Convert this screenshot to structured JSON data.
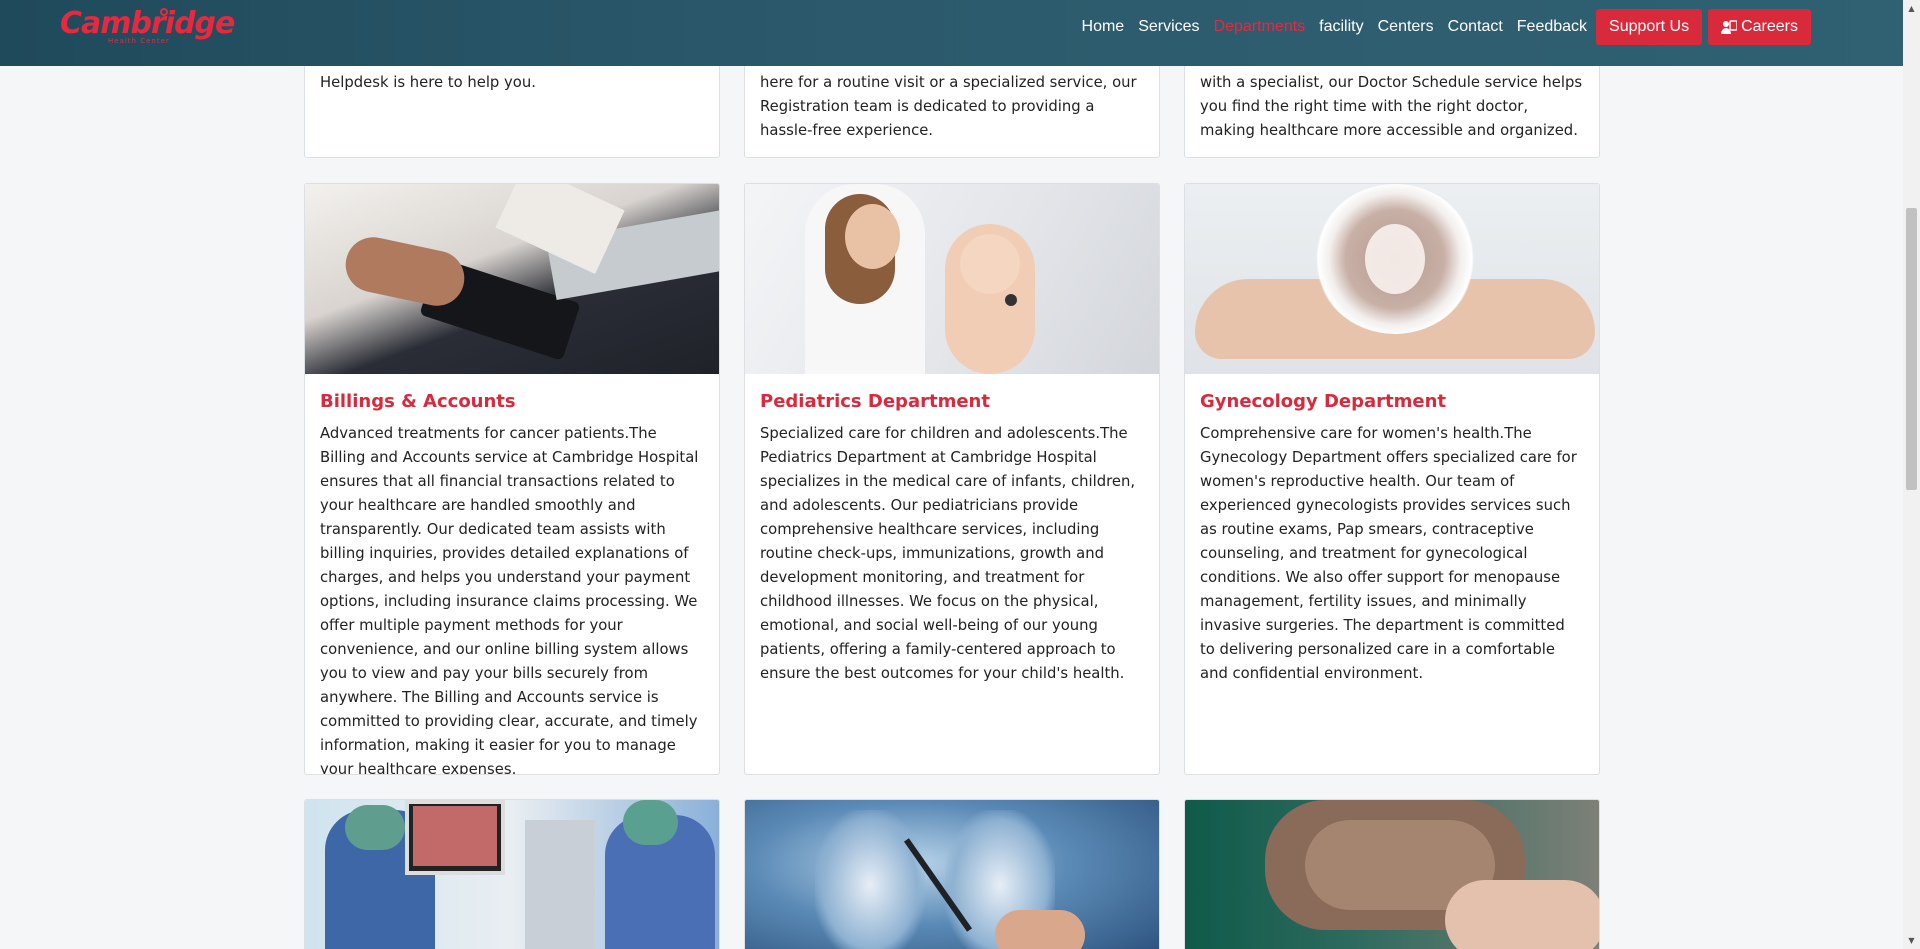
{
  "brand": {
    "name": "Cambridge",
    "tagline": "Health Center",
    "color": "#e8283f"
  },
  "nav": {
    "links": [
      "Home",
      "Services",
      "Departments",
      "facility",
      "Centers",
      "Contact",
      "Feedback"
    ],
    "active": "Departments",
    "support_label": "Support Us",
    "careers_label": "Careers"
  },
  "top_cards": [
    {
      "text": "Helpdesk is here to help you."
    },
    {
      "text": "here for a routine visit or a specialized service, our Registration team is dedicated to providing a hassle-free experience."
    },
    {
      "text": "with a specialist, our Doctor Schedule service helps you find the right time with the right doctor, making healthcare more accessible and organized."
    }
  ],
  "cards": [
    {
      "title": "Billings & Accounts",
      "image": "billing-calculator-image",
      "text": "Advanced treatments for cancer patients.The Billing and Accounts service at Cambridge Hospital ensures that all financial transactions related to your healthcare are handled smoothly and transparently. Our dedicated team assists with billing inquiries, provides detailed explanations of charges, and helps you understand your payment options, including insurance claims processing. We offer multiple payment methods for your convenience, and our online billing system allows you to view and pay your bills securely from anywhere. The Billing and Accounts service is committed to providing clear, accurate, and timely information, making it easier for you to manage your healthcare expenses."
    },
    {
      "title": "Pediatrics Department",
      "image": "pediatrician-baby-image",
      "text": "Specialized care for children and adolescents.The Pediatrics Department at Cambridge Hospital specializes in the medical care of infants, children, and adolescents. Our pediatricians provide comprehensive healthcare services, including routine check-ups, immunizations, growth and development monitoring, and treatment for childhood illnesses. We focus on the physical, emotional, and social well-being of our young patients, offering a family-centered approach to ensure the best outcomes for your child's health."
    },
    {
      "title": "Gynecology Department",
      "image": "hands-embryo-image",
      "text": "Comprehensive care for women's health.The Gynecology Department offers specialized care for women's reproductive health. Our team of experienced gynecologists provides services such as routine exams, Pap smears, contraceptive counseling, and treatment for gynecological conditions. We also offer support for menopause management, fertility issues, and minimally invasive surgeries. The department is committed to delivering personalized care in a comfortable and confidential environment."
    }
  ],
  "bottom_cards": [
    {
      "image": "endoscopy-procedure-image"
    },
    {
      "image": "chest-xray-image"
    },
    {
      "image": "elderly-hands-image"
    }
  ],
  "colors": {
    "header": "#2c5a6c",
    "accent": "#d9293c",
    "background": "#f5f6f8"
  }
}
